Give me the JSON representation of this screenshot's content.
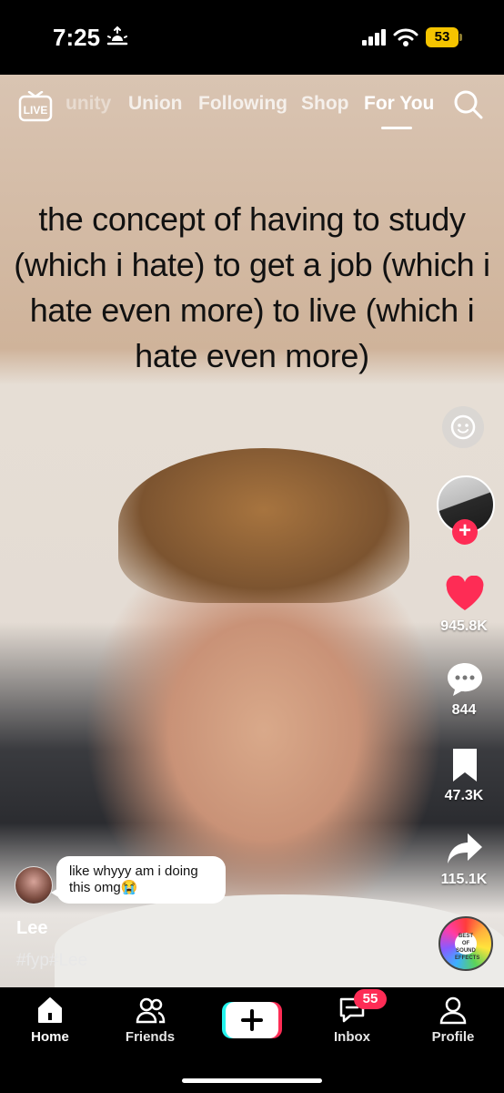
{
  "status_bar": {
    "time": "7:25",
    "battery": "53"
  },
  "top_nav": {
    "live_label": "LIVE",
    "tabs": [
      "unity",
      "Union",
      "Following",
      "Shop",
      "For You"
    ],
    "active_tab": "For You"
  },
  "video": {
    "caption": "the concept of having to study (which i hate) to get a job (which i hate even more) to live (which i hate even more)",
    "comment_text": "like whyyy am i doing this omg😭",
    "username": "Lee",
    "hashtags": "#fyp#Lee",
    "music_disc_text": "BEST OF SOUND EFFECTS"
  },
  "actions": {
    "likes": "945.8K",
    "comments": "844",
    "saves": "47.3K",
    "shares": "115.1K"
  },
  "colors": {
    "accent": "#fe2c55",
    "battery": "#f5c400"
  },
  "tab_bar": {
    "items": [
      {
        "label": "Home",
        "icon": "home-icon"
      },
      {
        "label": "Friends",
        "icon": "friends-icon"
      },
      {
        "label": "",
        "icon": "create-plus-icon"
      },
      {
        "label": "Inbox",
        "icon": "inbox-icon"
      },
      {
        "label": "Profile",
        "icon": "profile-icon"
      }
    ],
    "inbox_badge": "55"
  }
}
